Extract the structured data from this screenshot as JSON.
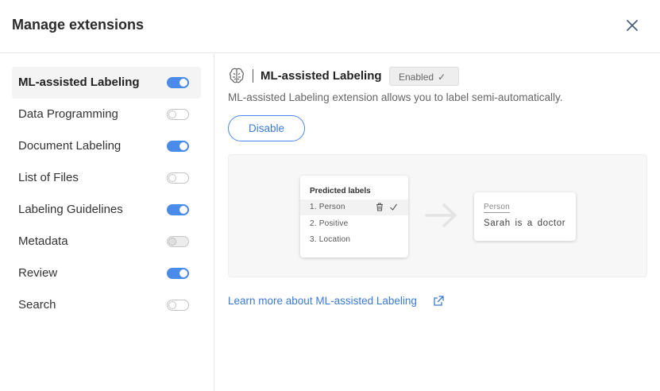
{
  "header": {
    "title": "Manage extensions"
  },
  "sidebar": {
    "items": [
      {
        "label": "ML-assisted Labeling",
        "state": "on",
        "active": true
      },
      {
        "label": "Data Programming",
        "state": "off",
        "active": false
      },
      {
        "label": "Document Labeling",
        "state": "on",
        "active": false
      },
      {
        "label": "List of Files",
        "state": "off",
        "active": false
      },
      {
        "label": "Labeling Guidelines",
        "state": "on",
        "active": false
      },
      {
        "label": "Metadata",
        "state": "disabled",
        "active": false
      },
      {
        "label": "Review",
        "state": "on",
        "active": false
      },
      {
        "label": "Search",
        "state": "off",
        "active": false
      }
    ]
  },
  "main": {
    "icon": "brain-icon",
    "title": "ML-assisted Labeling",
    "badge": "Enabled",
    "description": "ML-assisted Labeling extension allows you to label semi-automatically.",
    "disable_label": "Disable",
    "preview": {
      "card_title": "Predicted labels",
      "items": [
        "1. Person",
        "2. Positive",
        "3. Location"
      ],
      "result_label": "Person",
      "result_text": "Sarah is a doctor"
    },
    "learn_more": "Learn more about ML-assisted Labeling"
  },
  "colors": {
    "accent": "#4a8ae8",
    "link": "#3b79d6",
    "toggle_off_border": "#c4c4c4"
  }
}
